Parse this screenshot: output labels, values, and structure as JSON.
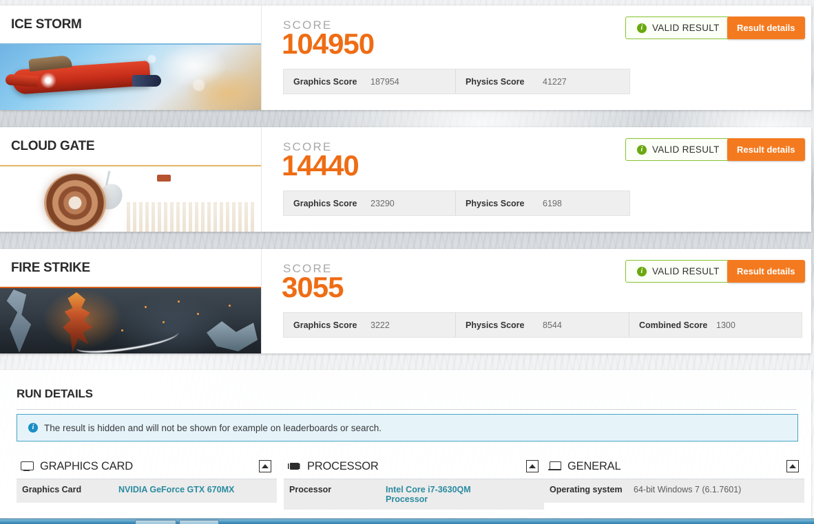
{
  "benchmarks": [
    {
      "name": "ICE STORM",
      "accent": "#7fb9e0",
      "score_label": "SCORE",
      "score": "104950",
      "validity": "VALID RESULT",
      "details_button": "Result details",
      "subscores": [
        {
          "label": "Graphics Score",
          "value": "187954"
        },
        {
          "label": "Physics Score",
          "value": "41227"
        }
      ]
    },
    {
      "name": "CLOUD GATE",
      "accent": "#e6b463",
      "score_label": "SCORE",
      "score": "14440",
      "validity": "VALID RESULT",
      "details_button": "Result details",
      "subscores": [
        {
          "label": "Graphics Score",
          "value": "23290"
        },
        {
          "label": "Physics Score",
          "value": "6198"
        }
      ]
    },
    {
      "name": "FIRE STRIKE",
      "accent": "#d9601d",
      "score_label": "SCORE",
      "score": "3055",
      "validity": "VALID RESULT",
      "details_button": "Result details",
      "subscores": [
        {
          "label": "Graphics Score",
          "value": "3222"
        },
        {
          "label": "Physics Score",
          "value": "8544"
        },
        {
          "label": "Combined Score",
          "value": "1300"
        }
      ]
    }
  ],
  "run_details": {
    "title": "RUN DETAILS",
    "notice": "The result is hidden and will not be shown for example on leaderboards or search.",
    "notice_icon": "info-icon",
    "sections": [
      {
        "title": "GRAPHICS CARD",
        "icon": "monitor-icon",
        "collapse_icon": "collapse-up-icon",
        "rows": [
          {
            "key": "Graphics Card",
            "value": "NVIDIA GeForce GTX 670MX",
            "link": true
          }
        ]
      },
      {
        "title": "PROCESSOR",
        "icon": "cpu-icon",
        "collapse_icon": "collapse-up-icon",
        "rows": [
          {
            "key": "Processor",
            "value": "Intel Core i7-3630QM Processor",
            "link": true
          }
        ]
      },
      {
        "title": "GENERAL",
        "icon": "laptop-icon",
        "collapse_icon": "collapse-up-icon",
        "rows": [
          {
            "key": "Operating system",
            "value": "64-bit Windows 7 (6.1.7601)",
            "link": false
          }
        ]
      }
    ]
  },
  "colors": {
    "accent_orange": "#ef6c14",
    "button_orange": "#f47a20",
    "valid_green": "#86c232",
    "link_teal": "#2a8ba0",
    "notice_blue": "#41a3c4"
  }
}
